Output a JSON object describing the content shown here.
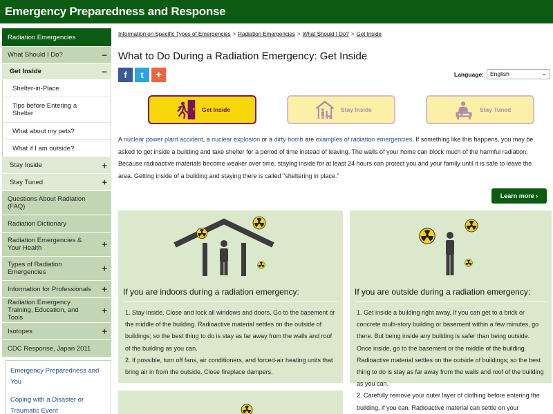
{
  "header": {
    "title": "Emergency Preparedness and Response"
  },
  "sidebar": {
    "root": "Radiation Emergencies",
    "items": [
      {
        "label": "What Should I Do?",
        "level": "l1",
        "toggle": "−"
      },
      {
        "label": "Get Inside",
        "level": "l2",
        "toggle": "−"
      },
      {
        "label": "Shelter-in-Place",
        "level": "l3",
        "toggle": ""
      },
      {
        "label": "Tips before Entering a Shelter",
        "level": "l3",
        "toggle": ""
      },
      {
        "label": "What about my pets?",
        "level": "l3",
        "toggle": ""
      },
      {
        "label": "What if I am outside?",
        "level": "l3",
        "toggle": ""
      },
      {
        "label": "Stay Inside",
        "level": "l2b",
        "toggle": "+"
      },
      {
        "label": "Stay Tuned",
        "level": "l2b",
        "toggle": "+"
      },
      {
        "label": "Questions About Radiation (FAQ)",
        "level": "l1",
        "toggle": ""
      },
      {
        "label": "Radiation Dictionary",
        "level": "l1",
        "toggle": ""
      },
      {
        "label": "Radiation Emergencies & Your Health",
        "level": "l1",
        "toggle": "+"
      },
      {
        "label": "Types of Radiation Emergencies",
        "level": "l1",
        "toggle": "+"
      },
      {
        "label": "Information for Professionals",
        "level": "l1",
        "toggle": "+"
      },
      {
        "label": "Radiation Emergency Training, Education, and Tools",
        "level": "l1",
        "toggle": "+"
      },
      {
        "label": "Isotopes",
        "level": "l1",
        "toggle": "+"
      },
      {
        "label": "CDC Response, Japan 2011",
        "level": "l1",
        "toggle": ""
      }
    ]
  },
  "related": {
    "links": [
      "Emergency Preparedness and You",
      "Coping with a Disaster or Traumatic Event"
    ]
  },
  "breadcrumb": {
    "items": [
      "Information on Specific Types of Emergencies",
      "Radiation Emergencies",
      "What Should I Do?",
      "Get Inside"
    ],
    "separator": ">"
  },
  "page": {
    "title": "What to Do During a Radiation Emergency: Get Inside"
  },
  "social": {
    "facebook": "f",
    "twitter": "t",
    "share": "+"
  },
  "language": {
    "label": "Language:",
    "selected": "English",
    "chevron": "⌄"
  },
  "steps": [
    {
      "label": "Get Inside",
      "icon": "running-into-door-icon"
    },
    {
      "label": "Stay Inside",
      "icon": "house-family-icon"
    },
    {
      "label": "Stay Tuned",
      "icon": "radio-listening-icon"
    }
  ],
  "intro": {
    "t1": "A ",
    "l1": "nuclear power plant accident",
    "t2": ", a ",
    "l2": "nuclear explosion",
    "t3": " or a ",
    "l3": "dirty bomb",
    "t4": " are ",
    "l4": "examples of radiation emergencies",
    "t5": ". If something like this happens, you may be asked to get inside a building and take shelter for a period of time instead of leaving. The walls of your home can block much of the harmful radiation. Because radioactive materials become weaker over time, staying inside for at least 24 hours can protect you and your family until it is safe to leave the area. Getting inside of a building and staying there is called \"sheltering in place.\""
  },
  "learn_more": "Learn more",
  "cards": {
    "indoors": {
      "heading": "If you are indoors during a radiation emergency:",
      "items": [
        "1. Stay inside. Close and lock all windows and doors. Go to the basement or the middle of the building. Radioactive material settles on the outside of buildings; so the best thing to do is stay as far away from the walls and roof of the building as you can.",
        "2. If possible, turn off fans, air conditioners, and forced-air heating units that bring air in from the outside. Close fireplace dampers."
      ]
    },
    "outdoors": {
      "heading": "If you are outside during a radiation emergency:",
      "items": [
        "1. Get inside a building right away. If you can get to a brick or concrete multi-story building or basement within a few minutes, go there. But being inside any building is safer than being outside. Once inside, go to the basement or the middle of the building. Radioactive material settles on the outside of buildings; so the best thing to do is stay as far away from the walls and roof of the building as you can.",
        "2. Carefully remove your outer layer of clothing before entering the building, if you can. Radioactive material can settle on your"
      ]
    }
  },
  "colors": {
    "header_green": "#0b5b12",
    "nav_l1": "#c3d6b4",
    "nav_l2": "#deead3",
    "card_bg": "#dae8cc",
    "link_blue": "#1f4d8f",
    "step_active": "#f7d60a",
    "step_inactive": "#fbf0a6",
    "step_border": "#7a1653"
  }
}
